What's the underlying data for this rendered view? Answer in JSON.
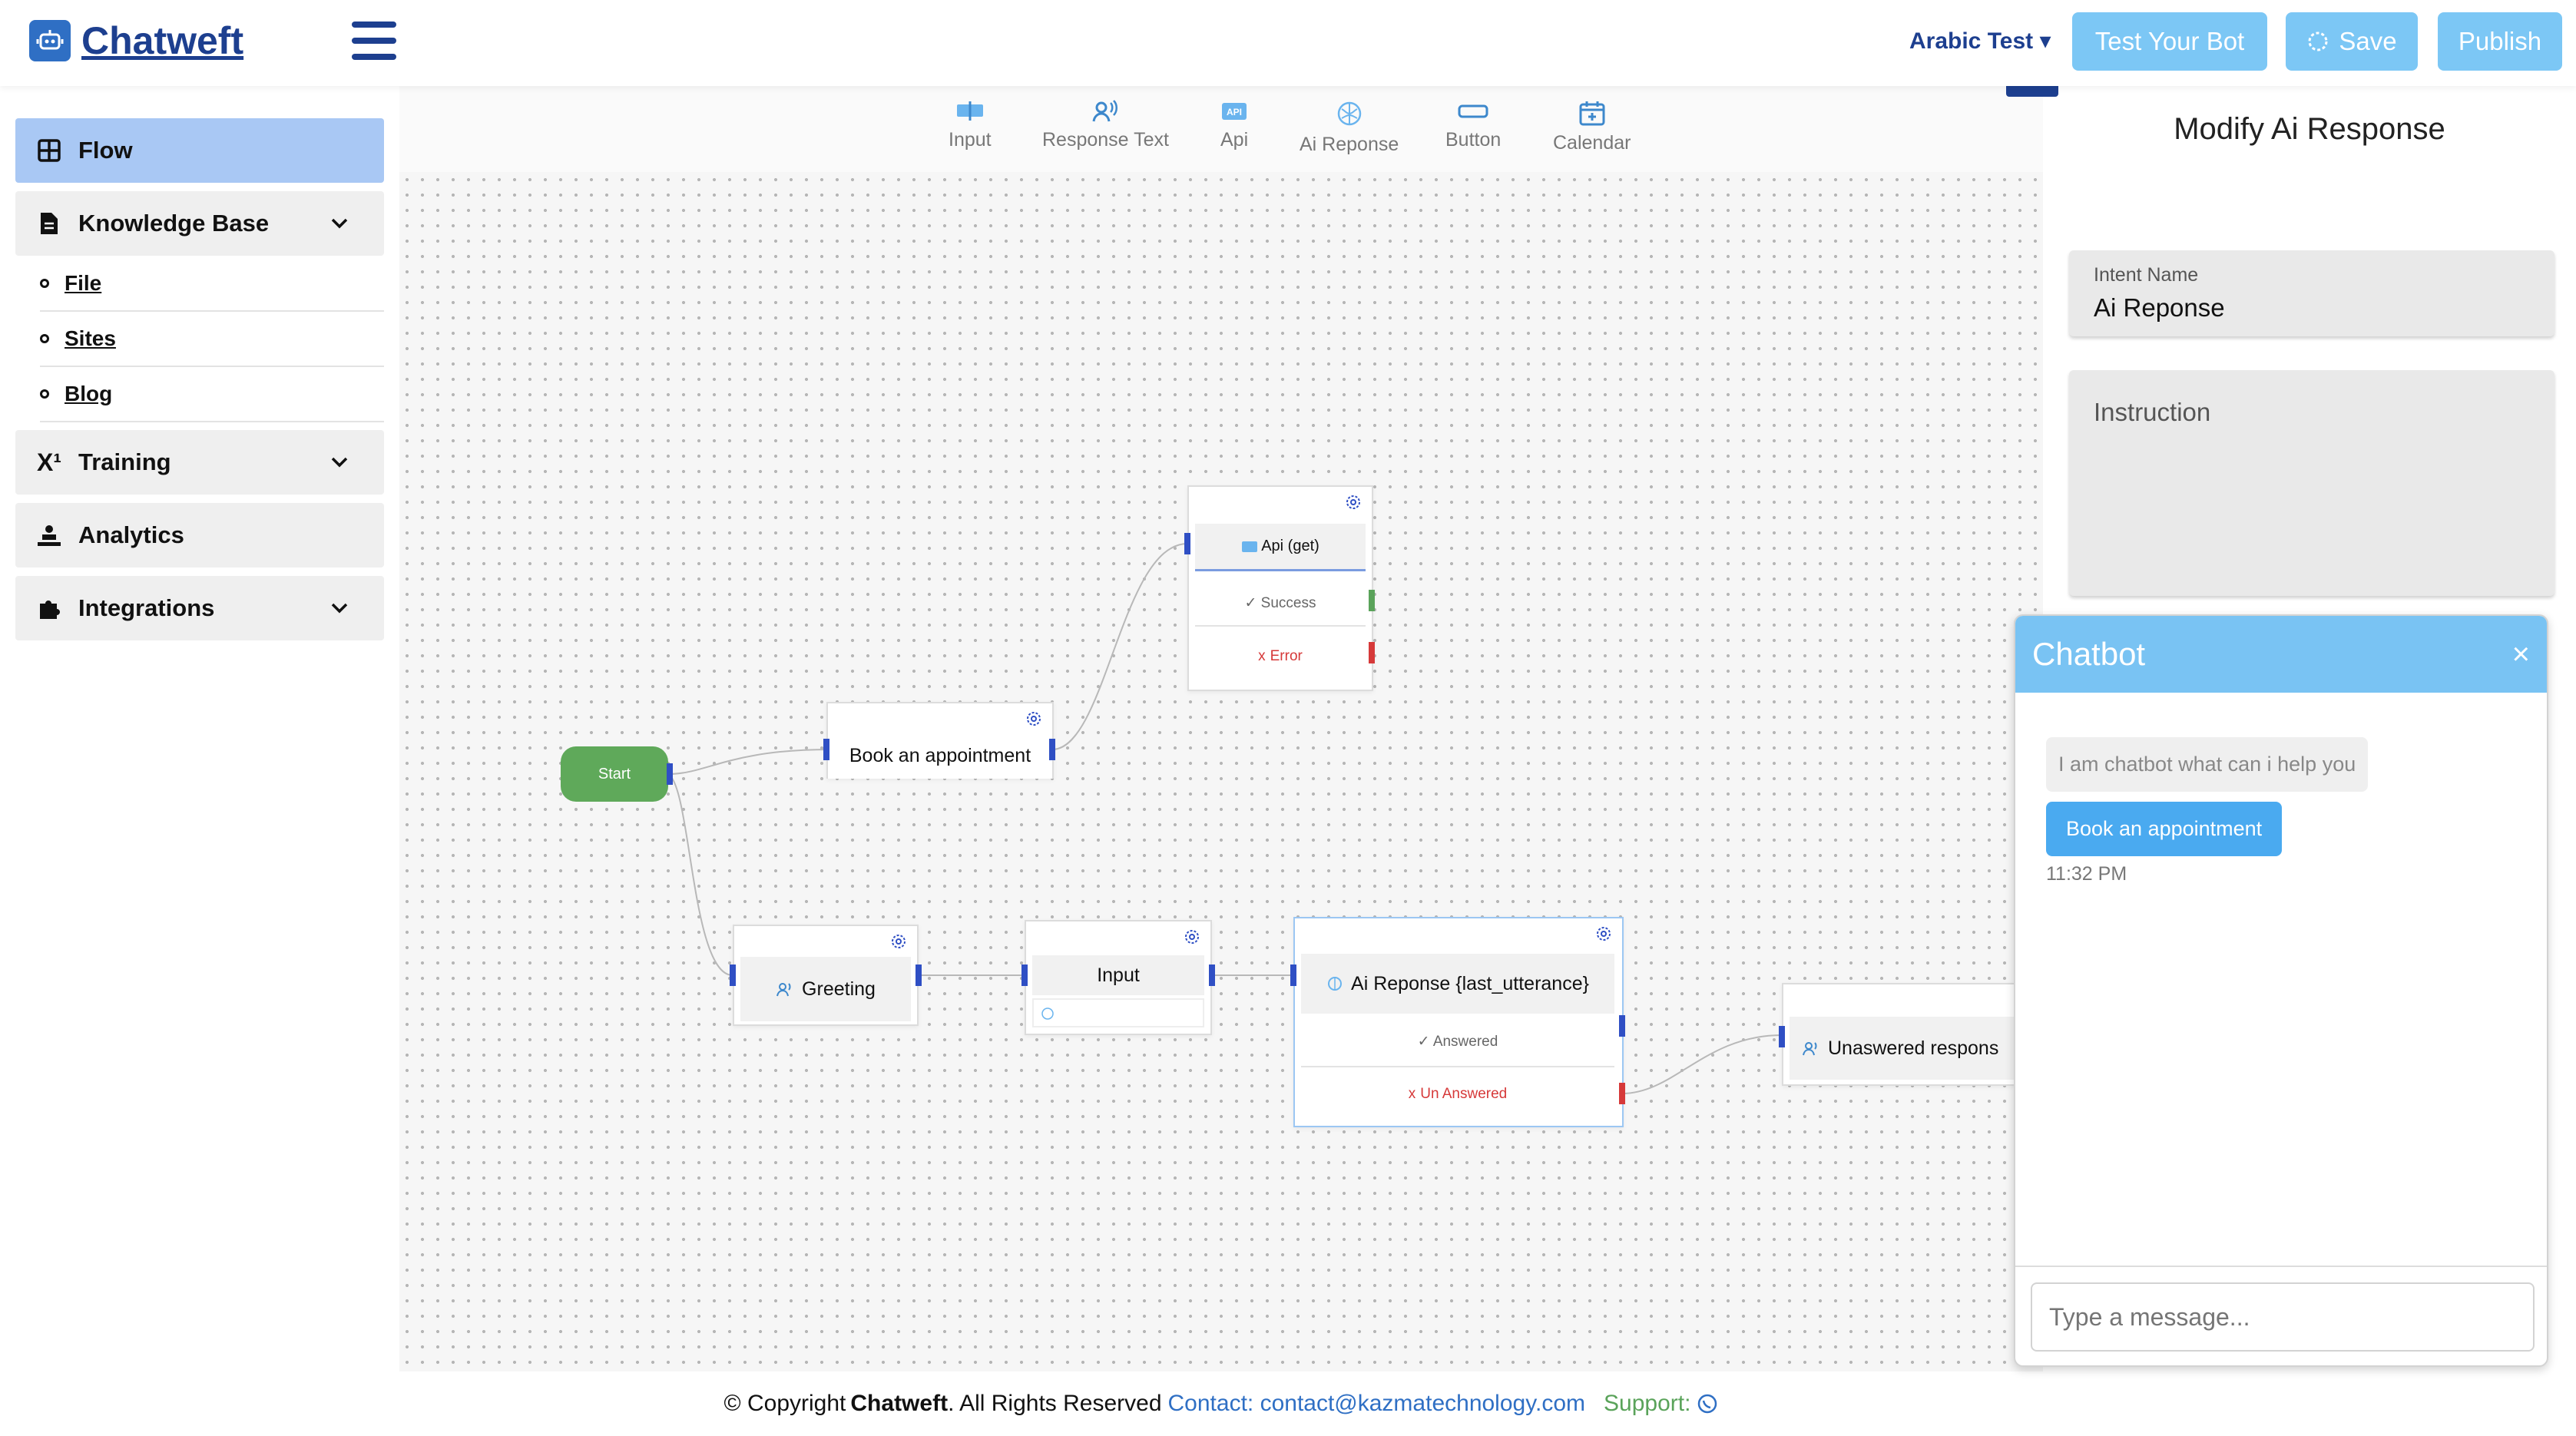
{
  "brand": {
    "name": "Chatweft"
  },
  "header": {
    "project": "Arabic Test ▾",
    "test_label": "Test Your Bot",
    "save_label": "Save",
    "publish_label": "Publish"
  },
  "sidebar": {
    "flow": "Flow",
    "knowledge": "Knowledge Base",
    "sub": [
      "File",
      "Sites",
      "Blog"
    ],
    "training": "Training",
    "analytics": "Analytics",
    "integrations": "Integrations"
  },
  "toolbar": {
    "items": [
      "Input",
      "Response Text",
      "Api",
      "Ai Reponse",
      "Button",
      "Calendar"
    ]
  },
  "nodes": {
    "start": "Start",
    "book": "Book an appointment",
    "api": "Api (get)",
    "api_success": "✓ Success",
    "api_error_x": "x",
    "api_error": "Error",
    "greeting": "Greeting",
    "input": "Input",
    "ai": "Ai Reponse {last_utterance}",
    "ai_answered": "✓ Answered",
    "ai_unanswered_x": "x",
    "ai_unanswered": "Un Answered",
    "unanswered": "Unaswered respons"
  },
  "footer": {
    "copyright_prefix": "© Copyright",
    "brand": "Chatweft",
    "copyright_suffix": ". All Rights Reserved",
    "contact": "Contact: contact@kazmatechnology.com",
    "support": "Support:"
  },
  "panel": {
    "close": "x",
    "title": "Modify Ai Response",
    "intent_label": "Intent Name",
    "intent_value": "Ai Reponse",
    "instruction_placeholder": "Instruction"
  },
  "chat": {
    "title": "Chatbot",
    "close": "×",
    "bot_msg": "I am chatbot what can i help you",
    "user_msg": "Book an appointment",
    "time": "11:32 PM",
    "placeholder": "Type a message..."
  },
  "colors": {
    "accent": "#1d3f8f",
    "light_button": "#7cc7f5",
    "chat_header": "#79c3f3",
    "start_node": "#5fa95a",
    "active_nav": "#a9c8f4"
  }
}
